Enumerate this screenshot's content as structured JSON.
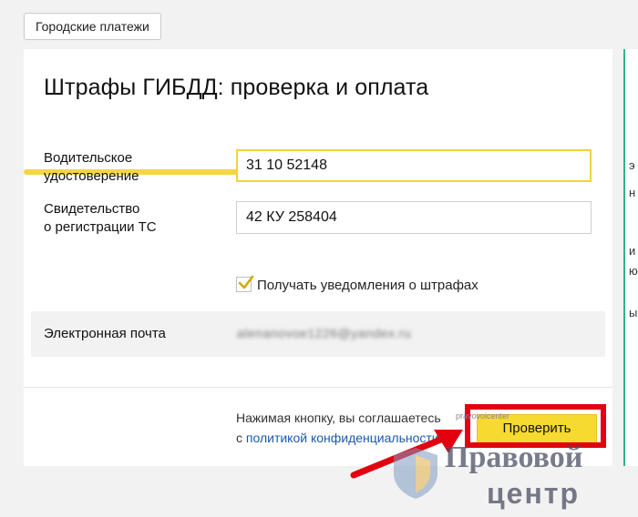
{
  "header": {
    "top_button_label": "Городские платежи"
  },
  "form": {
    "title": "Штрафы ГИБДД: проверка и оплата",
    "license": {
      "label_line1": "Водительское",
      "label_line2": "удостоверение",
      "value": "31 10 52148"
    },
    "registration": {
      "label_line1": "Свидетельство",
      "label_line2": "о регистрации ТС",
      "value": "42 КУ 258404"
    },
    "notifications": {
      "label": "Получать уведомления о штрафах",
      "checked": true
    },
    "email": {
      "label": "Электронная почта",
      "value": "alenanovoe1226@yandex.ru"
    },
    "agreement": {
      "text_line1": "Нажимая кнопку, вы соглашаетесь",
      "text_prefix2": "с",
      "policy_link": "политикой конфиденциальности"
    },
    "submit_label": "Проверить"
  },
  "annotations": {
    "mini_watermark": "pravovoicenter",
    "watermark_line1": "Правовой",
    "watermark_line2": "центр"
  },
  "right_panel": {
    "chars": [
      "э",
      "н",
      "и",
      "ю",
      "ы"
    ]
  },
  "colors": {
    "accent_yellow": "#f7da30",
    "progress_yellow": "#f5d546",
    "link_blue": "#1b5aa8",
    "highlight_red": "#e3000f",
    "panel_border_green": "#2bb58c"
  }
}
